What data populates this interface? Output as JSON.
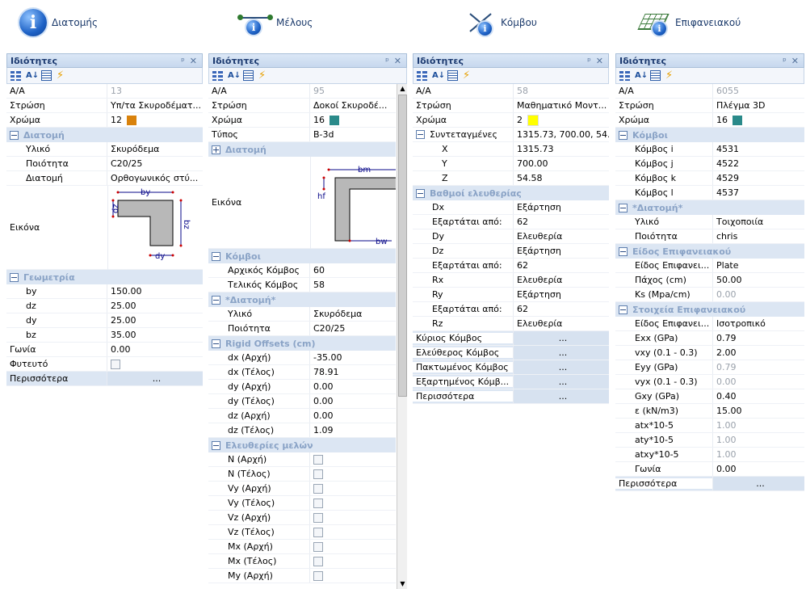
{
  "headers": [
    "Διατομής",
    "Μέλους",
    "Κόμβου",
    "Επιφανειακού"
  ],
  "title": "Ιδιότητες",
  "colors": {
    "orange": "#d9820c",
    "teal": "#2a8a8a",
    "yellow": "#ffff00",
    "accent": "#1c3a70"
  },
  "more": "Περισσότερα",
  "ellipsis": "...",
  "p1": {
    "rows1": [
      [
        "Α/Α",
        "13"
      ],
      [
        "Στρώση",
        "Υπ/τα Σκυροδέματ..."
      ],
      [
        "Χρώμα",
        "12"
      ]
    ],
    "cat1": "Διατομή",
    "rows2": [
      [
        "Υλικό",
        "Σκυρόδεμα"
      ],
      [
        "Ποιότητα",
        "C20/25"
      ],
      [
        "Διατομή",
        "Ορθογωνικός στύ..."
      ]
    ],
    "img": "Εικόνα",
    "dims": [
      "by",
      "dz",
      "bz",
      "dy"
    ],
    "cat2": "Γεωμετρία",
    "rows3": [
      [
        "by",
        "150.00"
      ],
      [
        "dz",
        "25.00"
      ],
      [
        "dy",
        "25.00"
      ],
      [
        "bz",
        "35.00"
      ]
    ],
    "rows4": [
      [
        "Γωνία",
        "0.00"
      ],
      [
        "Φυτευτό",
        ""
      ]
    ]
  },
  "p2": {
    "rows1": [
      [
        "Α/Α",
        "95"
      ],
      [
        "Στρώση",
        "Δοκοί Σκυροδέ..."
      ],
      [
        "Χρώμα",
        "16"
      ],
      [
        "Τύπος",
        "B-3d"
      ]
    ],
    "cat1": "Διατομή",
    "img": "Εικόνα",
    "dims": [
      "bm",
      "hf",
      "bw"
    ],
    "cat2": "Κόμβοι",
    "rows2": [
      [
        "Αρχικός Κόμβος",
        "60"
      ],
      [
        "Τελικός Κόμβος",
        "58"
      ]
    ],
    "cat3": "*Διατομή*",
    "rows3": [
      [
        "Υλικό",
        "Σκυρόδεμα"
      ],
      [
        "Ποιότητα",
        "C20/25"
      ]
    ],
    "cat4": "Rigid Offsets (cm)",
    "rows4": [
      [
        "dx (Αρχή)",
        "-35.00"
      ],
      [
        "dx (Τέλος)",
        "78.91"
      ],
      [
        "dy (Αρχή)",
        "0.00"
      ],
      [
        "dy (Τέλος)",
        "0.00"
      ],
      [
        "dz (Αρχή)",
        "0.00"
      ],
      [
        "dz (Τέλος)",
        "1.09"
      ]
    ],
    "cat5": "Ελευθερίες μελών",
    "rows5": [
      "N (Αρχή)",
      "N (Τέλος)",
      "Vy (Αρχή)",
      "Vy (Τέλος)",
      "Vz (Αρχή)",
      "Vz (Τέλος)",
      "Mx (Αρχή)",
      "Mx (Τέλος)",
      "My (Αρχή)"
    ]
  },
  "p3": {
    "rows1": [
      [
        "Α/Α",
        "58"
      ],
      [
        "Στρώση",
        "Μαθηματικό Μοντ..."
      ],
      [
        "Χρώμα",
        "2"
      ]
    ],
    "cat1": "Συντεταγμένες",
    "cat1v": "1315.73, 700.00, 54...",
    "rows2": [
      [
        "X",
        "1315.73"
      ],
      [
        "Y",
        "700.00"
      ],
      [
        "Z",
        "54.58"
      ]
    ],
    "cat2": "Βαθμοί ελευθερίας",
    "rows3": [
      [
        "Dx",
        "Εξάρτηση"
      ],
      [
        "Εξαρτάται από:",
        "62"
      ],
      [
        "Dy",
        "Ελευθερία"
      ],
      [
        "Dz",
        "Εξάρτηση"
      ],
      [
        "Εξαρτάται από:",
        "62"
      ],
      [
        "Rx",
        "Ελευθερία"
      ],
      [
        "Ry",
        "Εξάρτηση"
      ],
      [
        "Εξαρτάται από:",
        "62"
      ],
      [
        "Rz",
        "Ελευθερία"
      ]
    ],
    "links": [
      "Κύριος Κόμβος",
      "Ελεύθερος Κόμβος",
      "Πακτωμένος Κόμβος",
      "Εξαρτημένος Κόμβ...",
      "Περισσότερα"
    ]
  },
  "p4": {
    "rows1": [
      [
        "Α/Α",
        "6055"
      ],
      [
        "Στρώση",
        "Πλέγμα 3D"
      ],
      [
        "Χρώμα",
        "16"
      ]
    ],
    "cat1": "Κόμβοι",
    "rows2": [
      [
        "Κόμβος i",
        "4531"
      ],
      [
        "Κόμβος j",
        "4522"
      ],
      [
        "Κόμβος k",
        "4529"
      ],
      [
        "Κόμβος l",
        "4537"
      ]
    ],
    "cat2": "*Διατομή*",
    "rows3": [
      [
        "Υλικό",
        "Τοιχοποιία"
      ],
      [
        "Ποιότητα",
        "chris"
      ]
    ],
    "cat3": "Είδος Επιφανειακού",
    "rows4": [
      [
        "Είδος Επιφανει...",
        "Plate"
      ],
      [
        "Πάχος (cm)",
        "50.00"
      ],
      [
        "Ks (Mpa/cm)",
        "0.00"
      ]
    ],
    "cat4": "Στοιχεία Επιφανειακού",
    "rows5": [
      [
        "Είδος Επιφανει...",
        "Ισοτροπικό"
      ],
      [
        "Exx (GPa)",
        "0.79"
      ],
      [
        "vxy (0.1 - 0.3)",
        "2.00"
      ],
      [
        "Eyy (GPa)",
        "0.79"
      ],
      [
        "vyx (0.1 - 0.3)",
        "0.00"
      ],
      [
        "Gxy (GPa)",
        "0.40"
      ],
      [
        "ε (kN/m3)",
        "15.00"
      ],
      [
        "atx*10-5",
        "1.00"
      ],
      [
        "aty*10-5",
        "1.00"
      ],
      [
        "atxy*10-5",
        "1.00"
      ],
      [
        "Γωνία",
        "0.00"
      ]
    ]
  }
}
